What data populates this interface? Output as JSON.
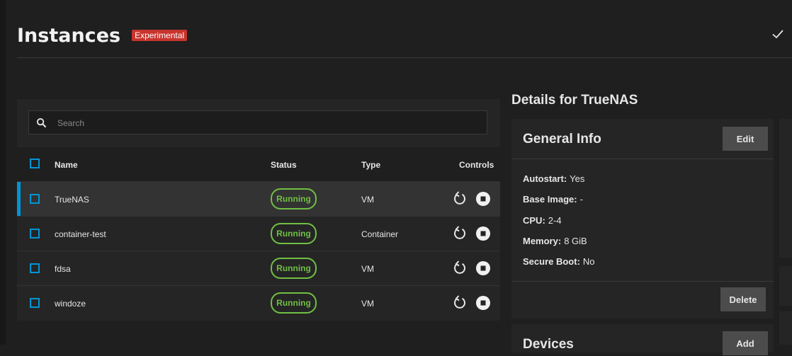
{
  "page": {
    "title": "Instances",
    "badge": "Experimental"
  },
  "search": {
    "placeholder": "Search"
  },
  "table": {
    "columns": {
      "name": "Name",
      "status": "Status",
      "type": "Type",
      "controls": "Controls"
    },
    "rows": [
      {
        "name": "TrueNAS",
        "status": "Running",
        "type": "VM"
      },
      {
        "name": "container-test",
        "status": "Running",
        "type": "Container"
      },
      {
        "name": "fdsa",
        "status": "Running",
        "type": "VM"
      },
      {
        "name": "windoze",
        "status": "Running",
        "type": "VM"
      }
    ]
  },
  "details": {
    "title": "Details for TrueNAS",
    "general_info": {
      "title": "General Info",
      "edit_label": "Edit",
      "delete_label": "Delete",
      "fields": [
        {
          "label": "Autostart:",
          "value": "Yes"
        },
        {
          "label": "Base Image:",
          "value": "-"
        },
        {
          "label": "CPU:",
          "value": "2-4"
        },
        {
          "label": "Memory:",
          "value": "8 GiB"
        },
        {
          "label": "Secure Boot:",
          "value": "No"
        }
      ]
    },
    "devices": {
      "title": "Devices",
      "add_label": "Add"
    }
  },
  "colors": {
    "accent": "#0095d5",
    "running": "#71bf44",
    "experimental_badge": "#c8332c",
    "background": "#1f1f1f",
    "card": "#252525"
  },
  "icons": [
    "check-icon",
    "search-icon",
    "restart-icon",
    "stop-icon"
  ]
}
